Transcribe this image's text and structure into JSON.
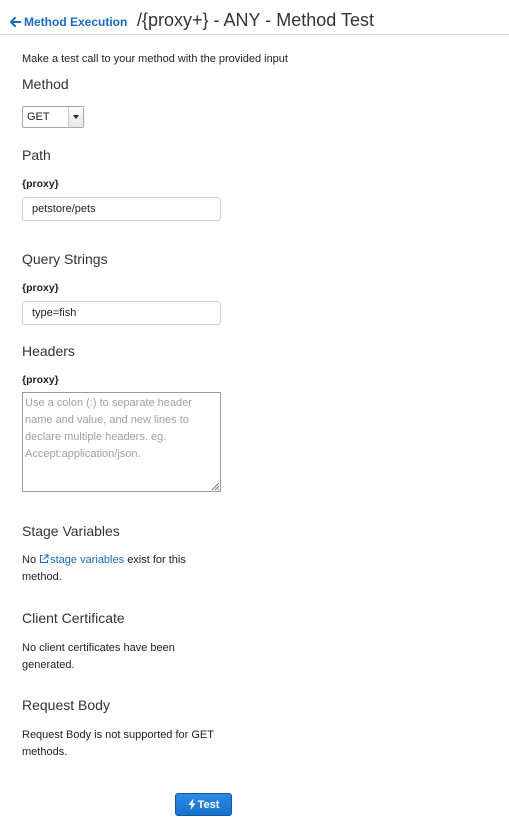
{
  "header": {
    "back_label": "Method Execution",
    "title": "/{proxy+} - ANY - Method Test"
  },
  "intro": "Make a test call to your method with the provided input",
  "method": {
    "heading": "Method",
    "selected": "GET"
  },
  "path": {
    "heading": "Path",
    "param_label": "{proxy}",
    "value": "petstore/pets"
  },
  "query": {
    "heading": "Query Strings",
    "param_label": "{proxy}",
    "value": "type=fish"
  },
  "headers": {
    "heading": "Headers",
    "param_label": "{proxy}",
    "value": "",
    "placeholder": "Use a colon (:) to separate header name and value, and new lines to declare multiple headers. eg. Accept:application/json."
  },
  "stage_variables": {
    "heading": "Stage Variables",
    "prefix": "No",
    "link_label": "stage variables",
    "line1_suffix": "exist for this",
    "line2": "method."
  },
  "client_certificate": {
    "heading": "Client Certificate",
    "line1": "No client certificates have been",
    "line2": "generated."
  },
  "request_body": {
    "heading": "Request Body",
    "line1": "Request Body is not supported for GET",
    "line2": "methods."
  },
  "test_button": {
    "label": "Test"
  },
  "colors": {
    "link": "#1a6bbd",
    "button": "#1e7ad9"
  },
  "icons": {
    "back": "arrow-left-icon",
    "external": "external-link-icon",
    "test": "bolt-icon"
  }
}
